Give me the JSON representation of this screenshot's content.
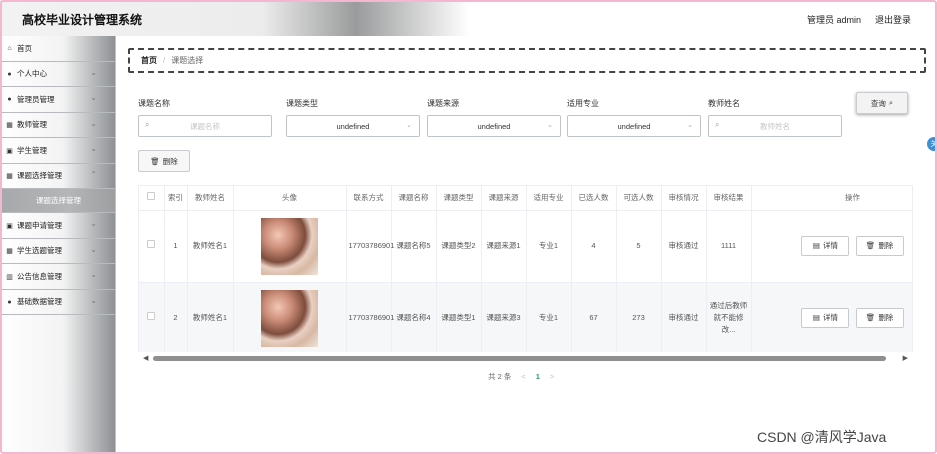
{
  "header": {
    "title": "高校毕业设计管理系统",
    "user": "管理员 admin",
    "logout": "退出登录"
  },
  "sidebar": {
    "items": [
      {
        "label": "首页",
        "icon": "home-icon",
        "glyph": "⌂",
        "chev": ""
      },
      {
        "label": "个人中心",
        "icon": "user-icon",
        "glyph": "●",
        "chev": "⌄"
      },
      {
        "label": "管理员管理",
        "icon": "user-icon",
        "glyph": "●",
        "chev": "⌄"
      },
      {
        "label": "教师管理",
        "icon": "grid-icon",
        "glyph": "▦",
        "chev": "⌄"
      },
      {
        "label": "学生管理",
        "icon": "check-icon",
        "glyph": "▣",
        "chev": "⌄"
      },
      {
        "label": "课题选择管理",
        "icon": "grid-icon",
        "glyph": "▦",
        "chev": "⌃"
      }
    ],
    "sub": "课题选择管理",
    "items2": [
      {
        "label": "课题申请管理",
        "icon": "check-icon",
        "glyph": "▣",
        "chev": "⌄"
      },
      {
        "label": "学生选题管理",
        "icon": "grid-icon",
        "glyph": "▦",
        "chev": "⌄"
      },
      {
        "label": "公告信息管理",
        "icon": "chart-icon",
        "glyph": "▥",
        "chev": "⌄"
      },
      {
        "label": "基础数据管理",
        "icon": "pin-icon",
        "glyph": "●",
        "chev": "⌄"
      }
    ]
  },
  "breadcrumb": {
    "home": "首页",
    "sep": "/",
    "current": "课题选择"
  },
  "search": {
    "title_label": "课题名称",
    "title_placeholder": "课题名称",
    "type_label": "课题类型",
    "type_value": "undefined",
    "source_label": "课题来源",
    "source_value": "undefined",
    "major_label": "适用专业",
    "major_value": "undefined",
    "teacher_label": "教师姓名",
    "teacher_placeholder": "教师姓名",
    "search_button": "查询",
    "delete_button": "删除"
  },
  "table": {
    "headers": [
      "",
      "索引",
      "教师姓名",
      "头像",
      "联系方式",
      "课题名称",
      "课题类型",
      "课题来源",
      "适用专业",
      "已选人数",
      "可选人数",
      "审核情况",
      "审核结果",
      "操作"
    ],
    "rows": [
      {
        "index": "1",
        "teacher": "教师姓名1",
        "phone": "17703786901",
        "name": "课题名称5",
        "type": "课题类型2",
        "source": "课题来源1",
        "major": "专业1",
        "selected": "4",
        "available": "5",
        "status": "审核通过",
        "result": "1111"
      },
      {
        "index": "2",
        "teacher": "教师姓名1",
        "phone": "17703786901",
        "name": "课题名称4",
        "type": "课题类型1",
        "source": "课题来源3",
        "major": "专业1",
        "selected": "67",
        "available": "273",
        "status": "审核通过",
        "result": "通过后教师就不能修改..."
      }
    ],
    "detail_button": "详情",
    "delete_button": "删除"
  },
  "pager": {
    "total": "共 2 条",
    "prev": "<",
    "page": "1",
    "next": ">"
  },
  "watermark": "CSDN @清风学Java",
  "side_tab": "关"
}
